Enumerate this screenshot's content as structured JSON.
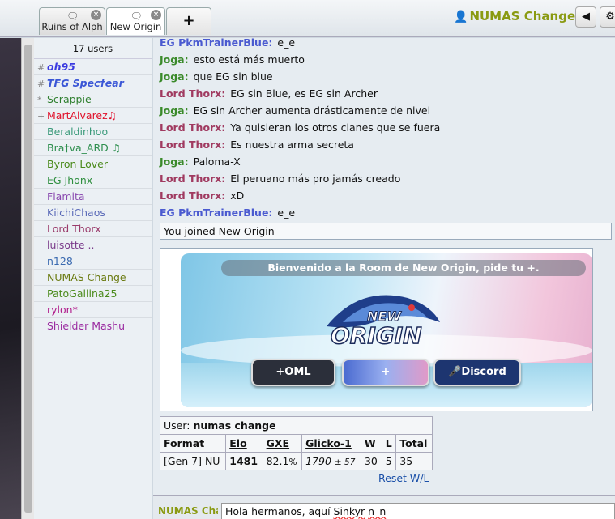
{
  "tabs": [
    {
      "label": "Ruins of Alph",
      "icon": "chat-bubble-icon"
    },
    {
      "label": "New Origin",
      "icon": "chat-bubble-icon"
    }
  ],
  "add_tab_label": "+",
  "header": {
    "username": "NUMAS Change",
    "mute_icon": "speaker-icon",
    "settings_icon": "gear-icon"
  },
  "userlist": {
    "count": "17 users",
    "users": [
      {
        "rank": "#",
        "name": "oh95",
        "color": "#3a3ae0",
        "bold": true,
        "italic": true
      },
      {
        "rank": "#",
        "name": "TFG Spec†ear",
        "color": "#3a56d6",
        "bold": true,
        "italic": true
      },
      {
        "rank": "*",
        "name": "Scrappie",
        "color": "#2f7f2f"
      },
      {
        "rank": "+",
        "name": "MartAlvarez♫",
        "color": "#e0102a"
      },
      {
        "rank": "",
        "name": "Beraldinhoo",
        "color": "#3a9a7a"
      },
      {
        "rank": "",
        "name": "Bra†va_ARD ♫",
        "color": "#2f8f4f"
      },
      {
        "rank": "",
        "name": "Byron Lover",
        "color": "#4a8a1a"
      },
      {
        "rank": "",
        "name": "EG Jhonx",
        "color": "#2f8f3f"
      },
      {
        "rank": "",
        "name": "Flamita",
        "color": "#8a4ab0"
      },
      {
        "rank": "",
        "name": "KiichiChaos",
        "color": "#5a6ab8"
      },
      {
        "rank": "",
        "name": "Lord Thorx",
        "color": "#9a3a6a"
      },
      {
        "rank": "",
        "name": "luisotte ..",
        "color": "#7a3a8a"
      },
      {
        "rank": "",
        "name": "n128",
        "color": "#3a6ab0"
      },
      {
        "rank": "",
        "name": "NUMAS Change",
        "color": "#6a7a10"
      },
      {
        "rank": "",
        "name": "PatoGallina25",
        "color": "#4a8a1a"
      },
      {
        "rank": "",
        "name": "rylon*",
        "color": "#b01a8a"
      },
      {
        "rank": "",
        "name": "Shielder Mashu",
        "color": "#9a2aa0"
      }
    ]
  },
  "messages": [
    {
      "user": "EG PkmTrainerBlue:",
      "text": "e_e",
      "color": "#4a5ad0"
    },
    {
      "user": "Joga:",
      "text": "esto está más muerto",
      "color": "#3a8a2a"
    },
    {
      "user": "Joga:",
      "text": "que EG sin blue",
      "color": "#3a8a2a"
    },
    {
      "user": "Lord Thorx:",
      "text": "EG sin Blue, es EG sin Archer",
      "color": "#a03a60"
    },
    {
      "user": "Joga:",
      "text": "EG sin Archer aumenta drásticamente de nivel",
      "color": "#3a8a2a"
    },
    {
      "user": "Lord Thorx:",
      "text": "Ya quisieran los otros clanes que se fuera",
      "color": "#a03a60"
    },
    {
      "user": "Lord Thorx:",
      "text": "Es nuestra arma secreta",
      "color": "#a03a60"
    },
    {
      "user": "Joga:",
      "text": "Paloma-X",
      "color": "#3a8a2a"
    },
    {
      "user": "Lord Thorx:",
      "text": "El peruano más pro jamás creado",
      "color": "#a03a60"
    },
    {
      "user": "Lord Thorx:",
      "text": "xD",
      "color": "#a03a60"
    },
    {
      "user": "EG PkmTrainerBlue:",
      "text": "e_e",
      "color": "#4a5ad0"
    }
  ],
  "joined_notice": "You joined New Origin",
  "banner": {
    "title": "Bienvenido a la Room de New Origin, pide tu +.",
    "logo_text_1": "NEW",
    "logo_text_2": "ORIGIN",
    "buttons": [
      {
        "label": "+OML",
        "icon": "plus-icon",
        "color": "#2b2f3a"
      },
      {
        "label": "",
        "icon": "plus-icon",
        "color": "#5a7ad8"
      },
      {
        "label": "Discord",
        "icon": "microphone-icon",
        "color": "#1d3570"
      }
    ]
  },
  "ratings": {
    "user_label": "User:",
    "user_value": "numas change",
    "headers": [
      "Format",
      "Elo",
      "GXE",
      "Glicko-1",
      "W",
      "L",
      "Total"
    ],
    "row": {
      "format": "[Gen 7] NU",
      "elo": "1481",
      "gxe": "82.1",
      "gxe_unit": "%",
      "glicko": "1790",
      "glicko_dev": "± 57",
      "w": "30",
      "l": "5",
      "total": "35"
    },
    "reset_label": "Reset W/L"
  },
  "input": {
    "name": "NUMAS Change",
    "value_plain": "Hola hermanos, aquí ",
    "value_flag1": "Sinkyr",
    "value_space": " ",
    "value_flag2": "n_n"
  }
}
